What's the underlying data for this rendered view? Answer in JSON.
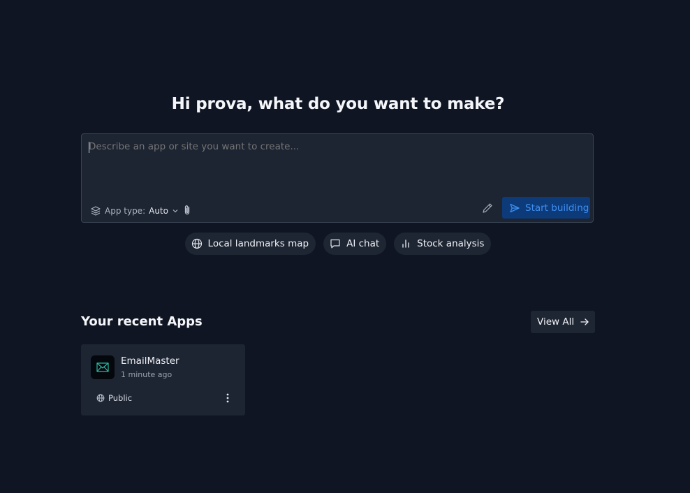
{
  "header": {
    "greeting": "Hi prova, what do you want to make?"
  },
  "composer": {
    "placeholder": "Describe an app or site you want to create...",
    "app_type_label": "App type:",
    "app_type_value": "Auto",
    "start_button_label": "Start building"
  },
  "suggestions": [
    {
      "label": "Local landmarks map",
      "icon": "globe-icon"
    },
    {
      "label": "AI chat",
      "icon": "chat-icon"
    },
    {
      "label": "Stock analysis",
      "icon": "bar-chart-icon"
    }
  ],
  "recent": {
    "title": "Your recent Apps",
    "view_all_label": "View All",
    "apps": [
      {
        "name": "EmailMaster",
        "time": "1 minute ago",
        "visibility": "Public",
        "icon": "mail-icon"
      }
    ]
  },
  "colors": {
    "background": "#0f1522",
    "panel": "#1d2432",
    "accent_button": "#0d3b7a",
    "accent_text": "#3f8ff0",
    "app_icon_glyph": "#2bb9a3"
  }
}
